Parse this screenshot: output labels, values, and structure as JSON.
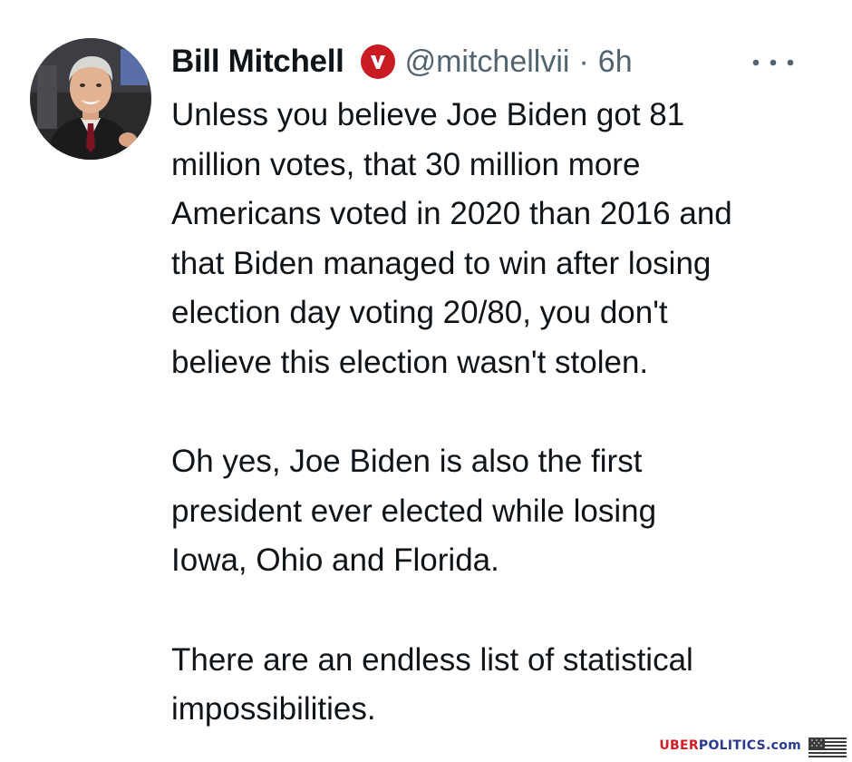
{
  "tweet": {
    "author_name": "Bill Mitchell",
    "handle": "@mitchellvii",
    "separator": "·",
    "time": "6h",
    "verified_badge_icon": "verified-v-badge",
    "more_icon": "more-options-icon",
    "colors": {
      "badge": "#c91c22",
      "secondary_text": "#536471",
      "primary_text": "#0f1419"
    },
    "paragraphs": [
      [
        "Unless you believe Joe Biden got 81",
        "million votes, that 30 million more",
        "Americans voted in 2020 than 2016 and",
        "that Biden managed to win after losing",
        "election day voting 20/80, you don't",
        "believe this election wasn't stolen."
      ],
      [
        "Oh yes, Joe Biden is also the first",
        "president ever elected while losing",
        "Iowa, Ohio and Florida."
      ],
      [
        "There are an endless list of statistical",
        "impossibilities."
      ]
    ]
  },
  "watermark": {
    "part1": "UBER",
    "part2": "POLITICS.com",
    "colors": {
      "part1": "#d11f26",
      "part2": "#2a3b8f"
    },
    "flag_icon": "us-flag-icon"
  }
}
